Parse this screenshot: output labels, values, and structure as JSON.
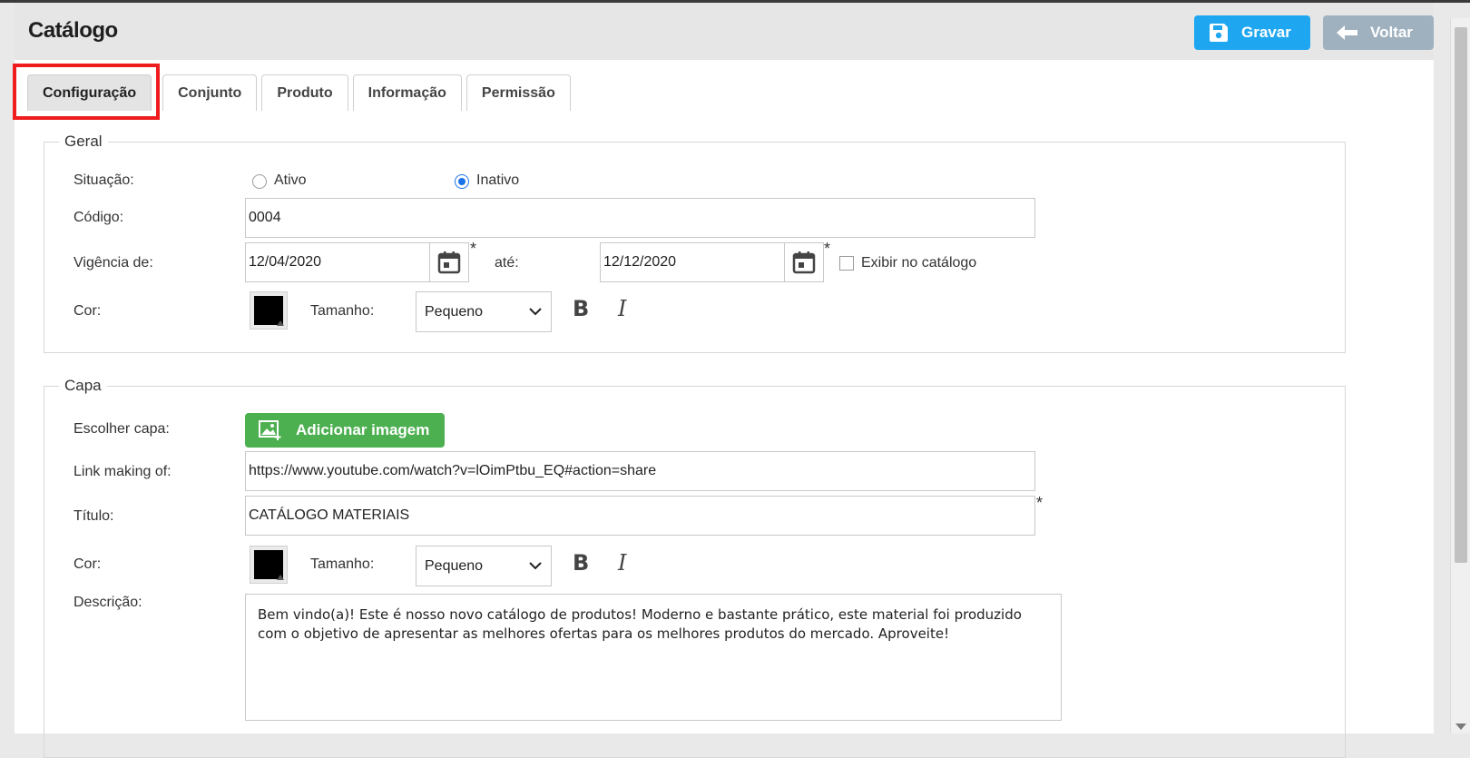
{
  "page": {
    "title": "Catálogo",
    "actions": {
      "save_label": "Gravar",
      "back_label": "Voltar"
    }
  },
  "tabs": [
    {
      "label": "Configuração",
      "active": true
    },
    {
      "label": "Conjunto",
      "active": false
    },
    {
      "label": "Produto",
      "active": false
    },
    {
      "label": "Informação",
      "active": false
    },
    {
      "label": "Permissão",
      "active": false
    }
  ],
  "geral": {
    "legend": "Geral",
    "situacao": {
      "label": "Situação:",
      "options": [
        "Ativo",
        "Inativo"
      ],
      "selected": "Inativo"
    },
    "codigo": {
      "label": "Código:",
      "value": "0004"
    },
    "vigencia": {
      "label": "Vigência de:",
      "from": "12/04/2020",
      "to_label": "até:",
      "to": "12/12/2020",
      "required_mark": "*",
      "show_in_catalog_label": "Exibir no catálogo",
      "show_in_catalog": false
    },
    "cor": {
      "label": "Cor:",
      "color": "#000000"
    },
    "tamanho": {
      "label": "Tamanho:",
      "value": "Pequeno"
    },
    "bold_label": "B",
    "italic_label": "I"
  },
  "capa": {
    "legend": "Capa",
    "escolher": {
      "label": "Escolher capa:",
      "button_label": "Adicionar imagem"
    },
    "link": {
      "label": "Link making of:",
      "value": "https://www.youtube.com/watch?v=lOimPtbu_EQ#action=share"
    },
    "titulo": {
      "label": "Título:",
      "value": "CATÁLOGO MATERIAIS",
      "required_mark": "*"
    },
    "cor": {
      "label": "Cor:",
      "color": "#000000"
    },
    "tamanho": {
      "label": "Tamanho:",
      "value": "Pequeno"
    },
    "bold_label": "B",
    "italic_label": "I",
    "descricao": {
      "label": "Descrição:",
      "value": "Bem vindo(a)! Este é nosso novo catálogo de produtos! Moderno e bastante prático, este material foi produzido com o objetivo de apresentar as melhores ofertas para os melhores produtos do mercado. Aproveite!"
    }
  },
  "colors": {
    "save": "#1ea7f0",
    "back": "#9fb1bf",
    "add_image": "#4caf50",
    "highlight": "#ee1c1c",
    "radio_checked": "#1a73e8"
  }
}
